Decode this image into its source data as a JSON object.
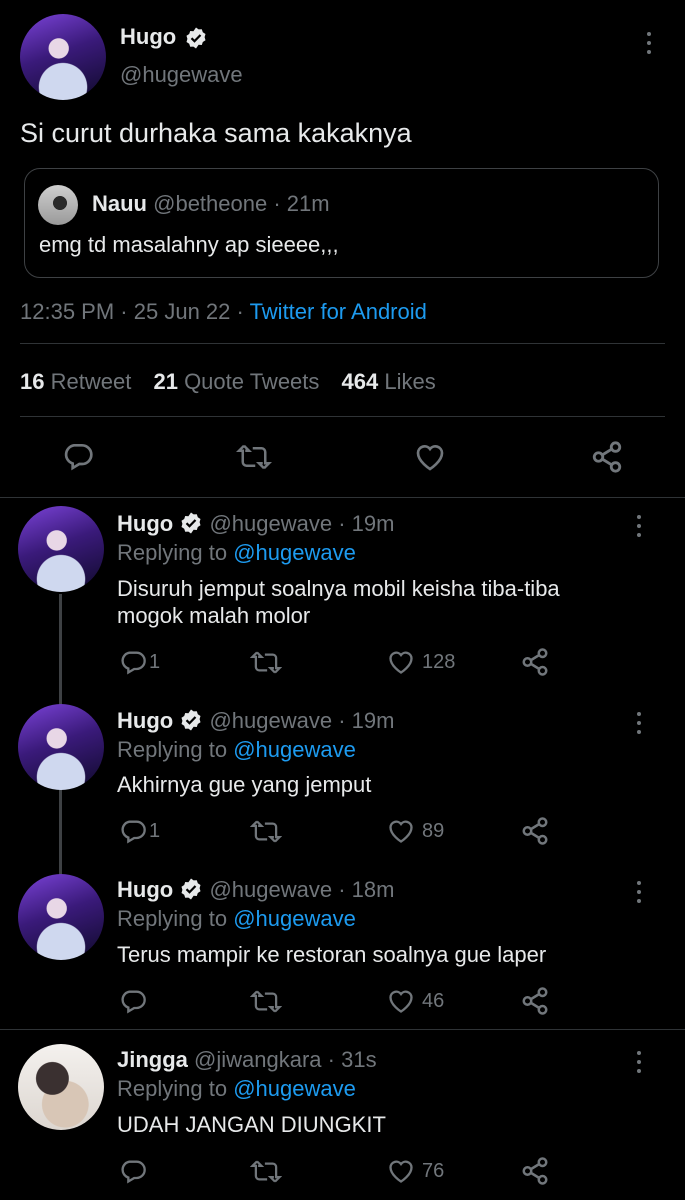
{
  "main": {
    "author": {
      "name": "Hugo",
      "handle": "@hugewave"
    },
    "text": "Si curut durhaka sama kakaknya",
    "quote": {
      "name": "Nauu",
      "handle": "@betheone",
      "time": "· 21m",
      "text": "emg td masalahny ap sieeee,,,"
    },
    "meta": {
      "time": "12:35 PM",
      "sep1": "·",
      "date": "25 Jun 22",
      "sep2": "·",
      "source": "Twitter for Android"
    },
    "stats": [
      {
        "count": "16",
        "label": "Retweet"
      },
      {
        "count": "21",
        "label": "Quote Tweets"
      },
      {
        "count": "464",
        "label": "Likes"
      }
    ]
  },
  "replies": [
    {
      "name": "Hugo",
      "handle": "@hugewave",
      "time": "· 19m",
      "replying_prefix": "Replying to",
      "replying_to": "@hugewave",
      "text_lines": [
        "Disuruh jemput soalnya mobil keisha tiba-tiba",
        "mogok malah molor"
      ],
      "reply_count": "1",
      "like_count": "128"
    },
    {
      "name": "Hugo",
      "handle": "@hugewave",
      "time": "· 19m",
      "replying_prefix": "Replying to",
      "replying_to": "@hugewave",
      "text_lines": [
        "Akhirnya gue yang jemput"
      ],
      "reply_count": "1",
      "like_count": "89"
    },
    {
      "name": "Hugo",
      "handle": "@hugewave",
      "time": "· 18m",
      "replying_prefix": "Replying to",
      "replying_to": "@hugewave",
      "text_lines": [
        "Terus mampir ke restoran soalnya gue laper"
      ],
      "reply_count": "",
      "like_count": "46"
    },
    {
      "name": "Jingga",
      "handle": "@jiwangkara",
      "time": "· 31s",
      "replying_prefix": "Replying to",
      "replying_to": "@hugewave",
      "text_lines": [
        "UDAH JANGAN DIUNGKIT"
      ],
      "reply_count": "",
      "like_count": "76"
    }
  ],
  "colors": {
    "background": "#000000",
    "text": "#e7e9ea",
    "muted": "#71767b",
    "link": "#1d9bf0",
    "divider": "#2f3336"
  },
  "icons": [
    "verified-badge-icon",
    "more-icon",
    "reply-icon",
    "retweet-icon",
    "like-icon",
    "share-icon"
  ]
}
